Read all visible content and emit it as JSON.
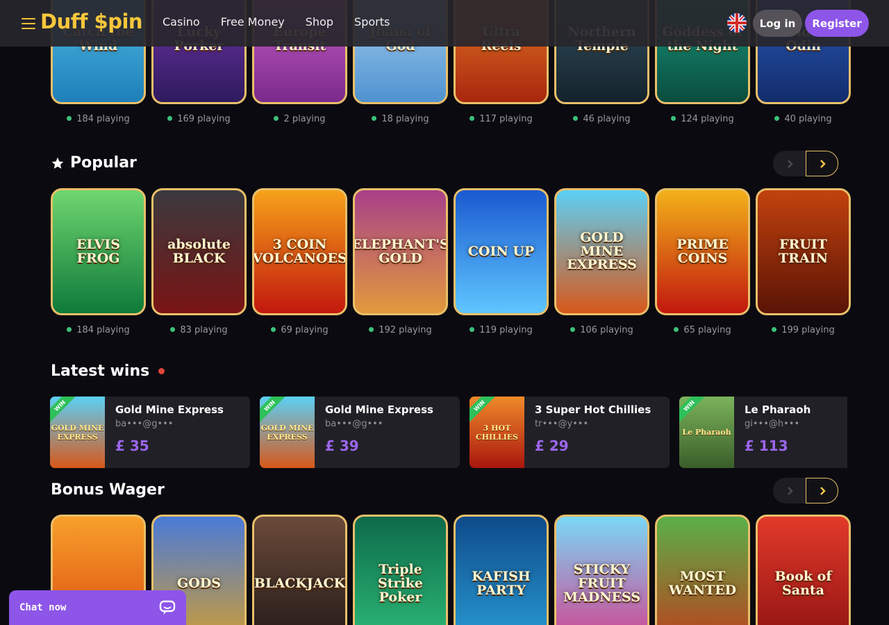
{
  "header": {
    "logo": "Duff $pin",
    "nav": [
      "Casino",
      "Free Money",
      "Shop",
      "Sports"
    ],
    "login": "Log in",
    "register": "Register"
  },
  "top_row": [
    {
      "title": "Catch the Wind",
      "playing": "184 playing",
      "bg": "#2aa6d8"
    },
    {
      "title": "Lucky Porker",
      "playing": "169 playing",
      "bg": "#5a2b8e"
    },
    {
      "title": "Europe Transit",
      "playing": "2 playing",
      "bg": "#b54ac0"
    },
    {
      "title": "Jhana of God",
      "playing": "18 playing",
      "bg": "#7fb7e4"
    },
    {
      "title": "Ultra Reels",
      "playing": "117 playing",
      "bg": "#c7461a"
    },
    {
      "title": "Northern Temple",
      "playing": "46 playing",
      "bg": "#233a4a"
    },
    {
      "title": "Goddess of the Night",
      "playing": "124 playing",
      "bg": "#0f6c5a"
    },
    {
      "title": "Gold of Odin",
      "playing": "40 playing",
      "bg": "#1d3f8f"
    }
  ],
  "popular": {
    "title": "Popular",
    "games": [
      {
        "title": "ELVIS FROG",
        "playing": "184 playing",
        "bg": "#1a9c4d"
      },
      {
        "title": "absolute BLACK",
        "playing": "83 playing",
        "bg": "#2b2b2e"
      },
      {
        "title": "3 COIN VOLCANOES",
        "playing": "69 playing",
        "bg": "#e4391b"
      },
      {
        "title": "ELEPHANT'S GOLD",
        "playing": "192 playing",
        "bg": "#c56e2c"
      },
      {
        "title": "COIN UP",
        "playing": "119 playing",
        "bg": "#1f7ee0"
      },
      {
        "title": "GOLD MINE EXPRESS",
        "playing": "106 playing",
        "bg": "#32a9dc"
      },
      {
        "title": "PRIME COINS",
        "playing": "65 playing",
        "bg": "#c2240f"
      },
      {
        "title": "FRUIT TRAIN",
        "playing": "199 playing",
        "bg": "#9a2a0c"
      }
    ]
  },
  "latest_wins": {
    "title": "Latest wins",
    "items": [
      {
        "game": "Gold Mine Express",
        "user": "ba•••@g•••",
        "amount": "£ 35",
        "thumb": "GOLD MINE EXPRESS",
        "bg": "#36a8d6"
      },
      {
        "game": "Gold Mine Express",
        "user": "ba•••@g•••",
        "amount": "£ 39",
        "thumb": "GOLD MINE EXPRESS",
        "bg": "#36a8d6"
      },
      {
        "game": "3 Super Hot Chillies",
        "user": "tr•••@y•••",
        "amount": "£ 29",
        "thumb": "3 HOT CHILLIES",
        "bg": "#d9431a"
      },
      {
        "game": "Le Pharaoh",
        "user": "gi•••@h•••",
        "amount": "£ 113",
        "thumb": "Le Pharaoh",
        "bg": "#5b8f4a"
      }
    ],
    "ribbon": "WIN"
  },
  "bonus_wager": {
    "title": "Bonus Wager",
    "games": [
      {
        "title": "",
        "bg": "#e3661a"
      },
      {
        "title": "GODS",
        "bg": "#2f4d9a"
      },
      {
        "title": "BLACKJACK",
        "bg": "#3b2a2a"
      },
      {
        "title": "Triple Strike Poker",
        "bg": "#1a8f5a"
      },
      {
        "title": "KAFISH PARTY",
        "bg": "#1b6fb2"
      },
      {
        "title": "STICKY FRUIT MADNESS",
        "bg": "#40b8d8"
      },
      {
        "title": "MOST WANTED",
        "bg": "#5a9a3a"
      },
      {
        "title": "Book of Santa",
        "bg": "#c22020"
      }
    ]
  },
  "chat": {
    "label": "Chat now"
  },
  "colors": {
    "accent": "#8d55e8",
    "gold": "#f6c63b",
    "online": "#3cc27a",
    "live": "#e0453a"
  }
}
